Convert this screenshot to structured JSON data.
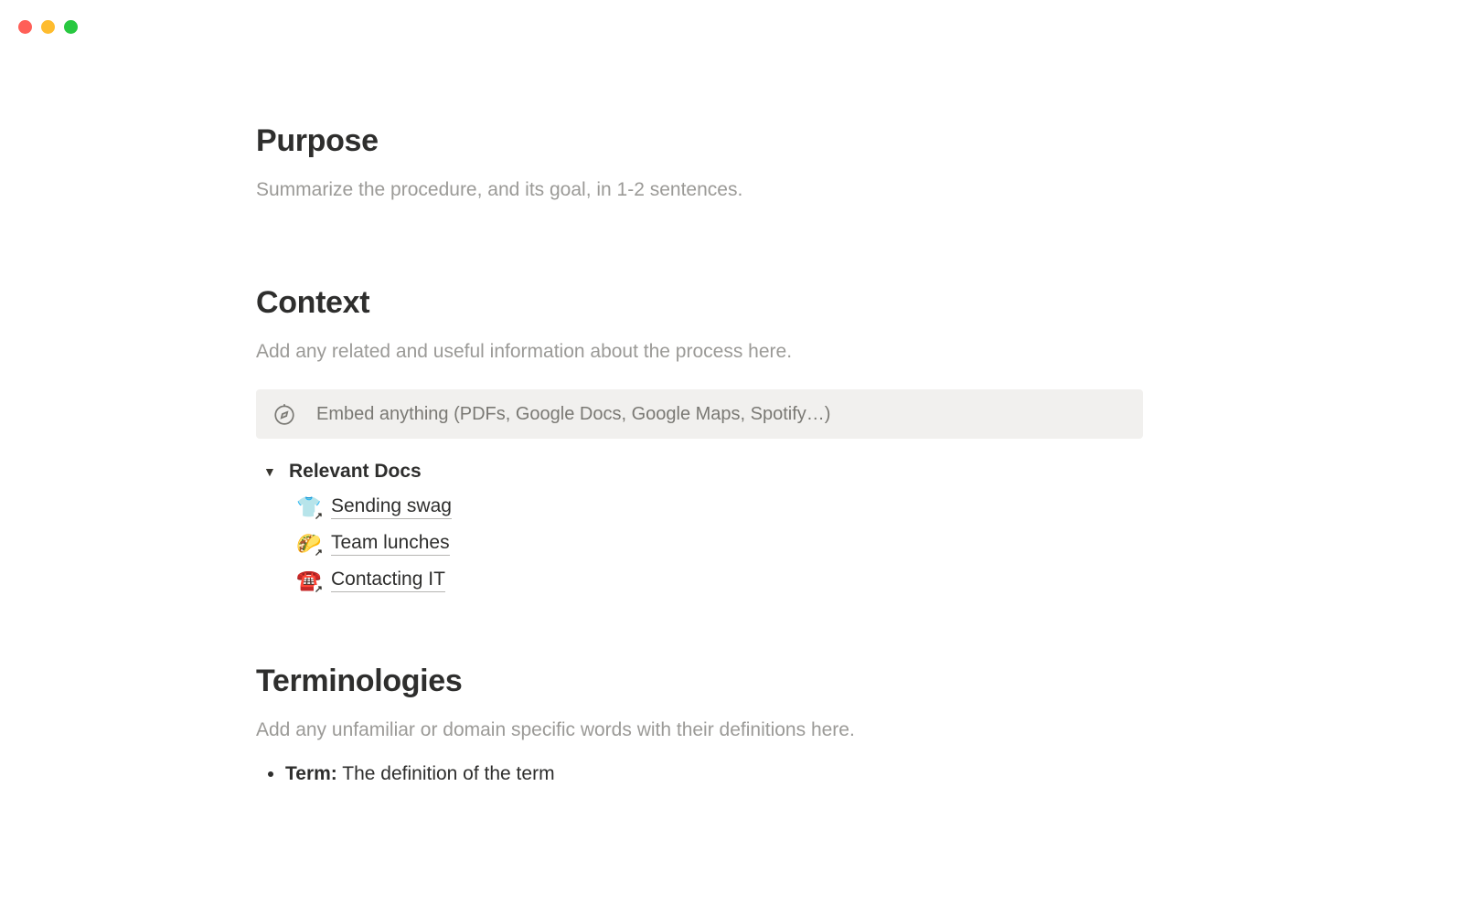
{
  "sections": {
    "purpose": {
      "heading": "Purpose",
      "sub": "Summarize the procedure, and its goal, in 1-2 sentences."
    },
    "context": {
      "heading": "Context",
      "sub": "Add any related and useful information about the process here.",
      "embed_placeholder": "Embed anything (PDFs, Google Docs, Google Maps, Spotify…)",
      "toggle": {
        "title": "Relevant Docs",
        "items": [
          {
            "emoji": "👕",
            "label": "Sending swag"
          },
          {
            "emoji": "🌮",
            "label": "Team lunches"
          },
          {
            "emoji": "☎️",
            "label": "Contacting IT"
          }
        ]
      }
    },
    "terminologies": {
      "heading": "Terminologies",
      "sub": "Add any unfamiliar or domain specific words with their definitions here.",
      "term_label": "Term:",
      "term_def": "The definition of the term"
    }
  }
}
